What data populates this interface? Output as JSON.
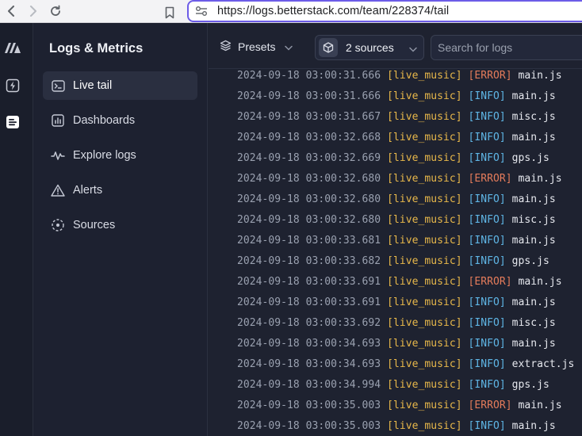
{
  "browser": {
    "url": "https://logs.betterstack.com/team/228374/tail"
  },
  "sidebar": {
    "title": "Logs & Metrics",
    "items": [
      {
        "label": "Live tail"
      },
      {
        "label": "Dashboards"
      },
      {
        "label": "Explore logs"
      },
      {
        "label": "Alerts"
      },
      {
        "label": "Sources"
      }
    ]
  },
  "toolbar": {
    "presets_label": "Presets",
    "sources_label": "2 sources",
    "search_placeholder": "Search for logs"
  },
  "logs": [
    {
      "ts": "2024-09-18 03:00:31.666",
      "source": "[live_music]",
      "level": "[ERROR]",
      "file": "main.js"
    },
    {
      "ts": "2024-09-18 03:00:31.666",
      "source": "[live_music]",
      "level": "[INFO]",
      "file": "main.js"
    },
    {
      "ts": "2024-09-18 03:00:31.667",
      "source": "[live_music]",
      "level": "[INFO]",
      "file": "misc.js"
    },
    {
      "ts": "2024-09-18 03:00:32.668",
      "source": "[live_music]",
      "level": "[INFO]",
      "file": "main.js"
    },
    {
      "ts": "2024-09-18 03:00:32.669",
      "source": "[live_music]",
      "level": "[INFO]",
      "file": "gps.js"
    },
    {
      "ts": "2024-09-18 03:00:32.680",
      "source": "[live_music]",
      "level": "[ERROR]",
      "file": "main.js"
    },
    {
      "ts": "2024-09-18 03:00:32.680",
      "source": "[live_music]",
      "level": "[INFO]",
      "file": "main.js"
    },
    {
      "ts": "2024-09-18 03:00:32.680",
      "source": "[live_music]",
      "level": "[INFO]",
      "file": "misc.js"
    },
    {
      "ts": "2024-09-18 03:00:33.681",
      "source": "[live_music]",
      "level": "[INFO]",
      "file": "main.js"
    },
    {
      "ts": "2024-09-18 03:00:33.682",
      "source": "[live_music]",
      "level": "[INFO]",
      "file": "gps.js"
    },
    {
      "ts": "2024-09-18 03:00:33.691",
      "source": "[live_music]",
      "level": "[ERROR]",
      "file": "main.js"
    },
    {
      "ts": "2024-09-18 03:00:33.691",
      "source": "[live_music]",
      "level": "[INFO]",
      "file": "main.js"
    },
    {
      "ts": "2024-09-18 03:00:33.692",
      "source": "[live_music]",
      "level": "[INFO]",
      "file": "misc.js"
    },
    {
      "ts": "2024-09-18 03:00:34.693",
      "source": "[live_music]",
      "level": "[INFO]",
      "file": "main.js"
    },
    {
      "ts": "2024-09-18 03:00:34.693",
      "source": "[live_music]",
      "level": "[INFO]",
      "file": "extract.js"
    },
    {
      "ts": "2024-09-18 03:00:34.994",
      "source": "[live_music]",
      "level": "[INFO]",
      "file": "gps.js"
    },
    {
      "ts": "2024-09-18 03:00:35.003",
      "source": "[live_music]",
      "level": "[ERROR]",
      "file": "main.js"
    },
    {
      "ts": "2024-09-18 03:00:35.003",
      "source": "[live_music]",
      "level": "[INFO]",
      "file": "main.js"
    }
  ]
}
